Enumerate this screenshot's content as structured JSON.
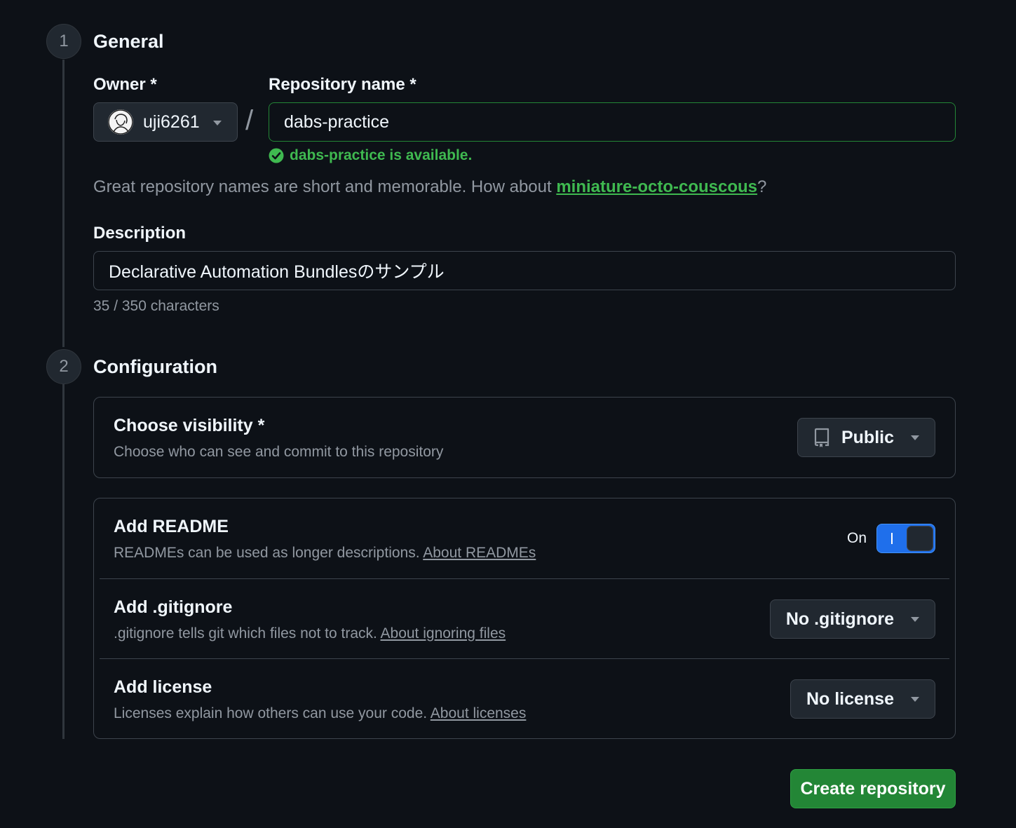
{
  "steps": [
    {
      "number": "1",
      "title": "General"
    },
    {
      "number": "2",
      "title": "Configuration"
    }
  ],
  "owner": {
    "label": "Owner *",
    "value": "uji6261"
  },
  "repository": {
    "label": "Repository name *",
    "value": "dabs-practice",
    "availability": "dabs-practice is available.",
    "hint_prefix": "Great repository names are short and memorable. How about ",
    "hint_suggestion": "miniature-octo-couscous",
    "hint_suffix": "?"
  },
  "description": {
    "label": "Description",
    "value": "Declarative Automation Bundlesのサンプル",
    "char_count": "35 / 350 characters"
  },
  "visibility": {
    "title": "Choose visibility *",
    "desc": "Choose who can see and commit to this repository",
    "selected": "Public"
  },
  "readme": {
    "title": "Add README",
    "desc": "READMEs can be used as longer descriptions. ",
    "link": "About READMEs",
    "toggle_label": "On"
  },
  "gitignore": {
    "title": "Add .gitignore",
    "desc": ".gitignore tells git which files not to track. ",
    "link": "About ignoring files",
    "selected": "No .gitignore"
  },
  "license": {
    "title": "Add license",
    "desc": "Licenses explain how others can use your code. ",
    "link": "About licenses",
    "selected": "No license"
  },
  "create_button": "Create repository",
  "colors": {
    "background": "#0d1117",
    "accent_green": "#238636",
    "success_text": "#3fb950",
    "toggle_blue": "#1f6feb"
  },
  "icons": {
    "owner_avatar": "user-avatar",
    "availability": "check-circle-icon",
    "visibility": "repo-icon",
    "dropdown": "caret-down-icon"
  }
}
